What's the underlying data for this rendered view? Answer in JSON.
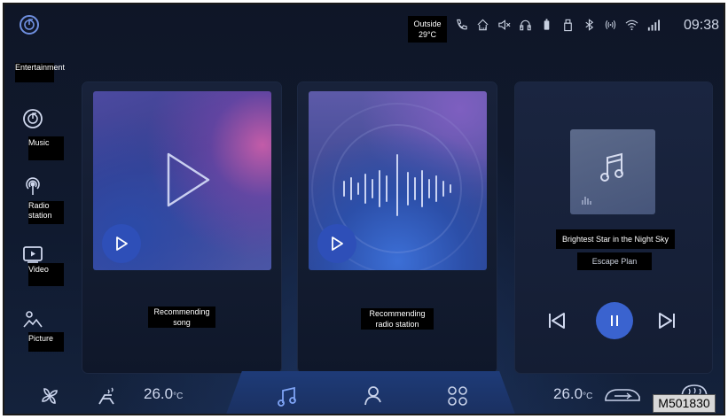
{
  "status": {
    "outside_label": "Outside",
    "outside_temp": "29°C",
    "clock": "09:38",
    "icons": [
      "phone-icon",
      "car-lock-icon",
      "mute-icon",
      "headset-icon",
      "battery-icon",
      "usb-icon",
      "bluetooth-icon",
      "wireless-icon",
      "wifi-icon",
      "cellular-icon"
    ]
  },
  "sidebar": {
    "header": "Entertainment",
    "items": [
      {
        "label": "Music",
        "icon": "music-disc-icon"
      },
      {
        "label": "Radio station",
        "icon": "radio-icon"
      },
      {
        "label": "Video",
        "icon": "video-icon"
      },
      {
        "label": "Picture",
        "icon": "picture-icon"
      }
    ]
  },
  "cards": {
    "song_label": "Recommending song",
    "radio_label": "Recommending radio station"
  },
  "now_playing": {
    "title": "Brightest Star in the Night Sky",
    "artist": "Escape Plan"
  },
  "bottom": {
    "left_temp": "26.0",
    "right_temp": "26.0",
    "temp_unit": "°C",
    "dock_icons": [
      "music-note-icon",
      "person-icon",
      "apps-grid-icon"
    ]
  },
  "figure_code": "M501830",
  "colors": {
    "accent": "#3a63cf",
    "background": "#0d1422"
  }
}
